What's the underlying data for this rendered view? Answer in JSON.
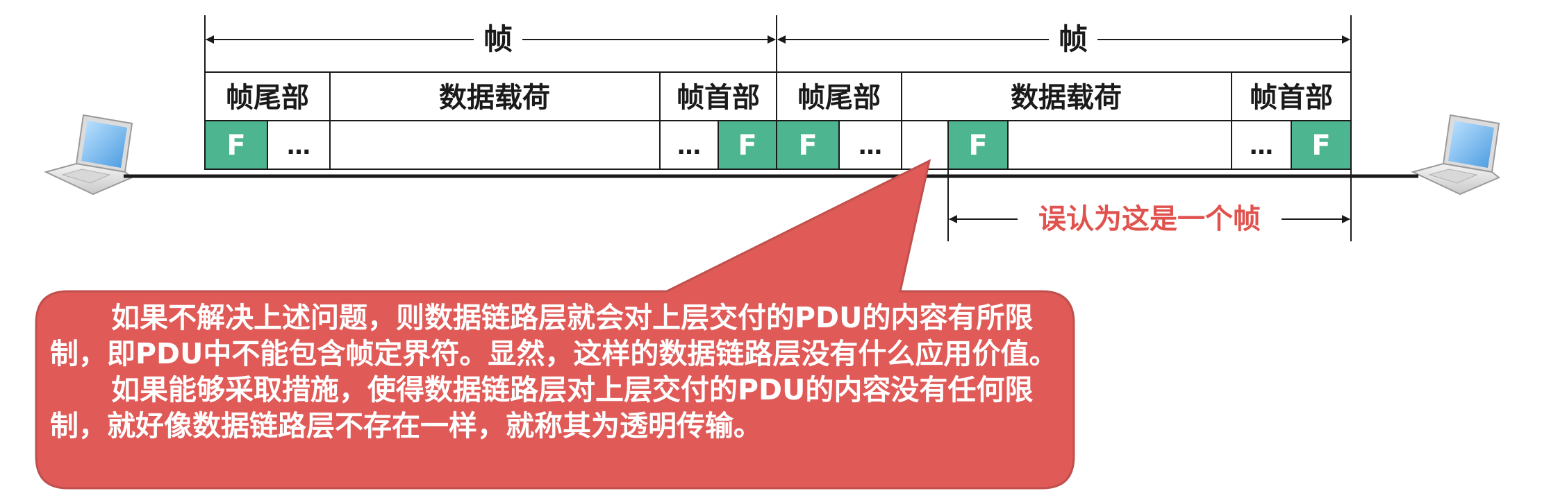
{
  "frames": {
    "frame_label": "帧",
    "trailer_label": "帧尾部",
    "payload_label": "数据载荷",
    "header_label": "帧首部",
    "flag_label": "F",
    "ellipsis": "…"
  },
  "misinterpret_label": "误认为这是一个帧",
  "callout": {
    "paragraph1": "如果不解决上述问题，则数据链路层就会对上层交付的PDU的内容有所限制，即PDU中不能包含帧定界符。显然，这样的数据链路层没有什么应用价值。",
    "paragraph2": "如果能够采取措施，使得数据链路层对上层交付的PDU的内容没有任何限制，就好像数据链路层不存在一样，就称其为透明传输。"
  },
  "colors": {
    "flag_fill": "#4db58f",
    "callout_fill": "#e05a57",
    "callout_stroke": "#c0504d",
    "accent_text": "#e0524e"
  },
  "icons": [
    "laptop-icon-left",
    "laptop-icon-right"
  ]
}
